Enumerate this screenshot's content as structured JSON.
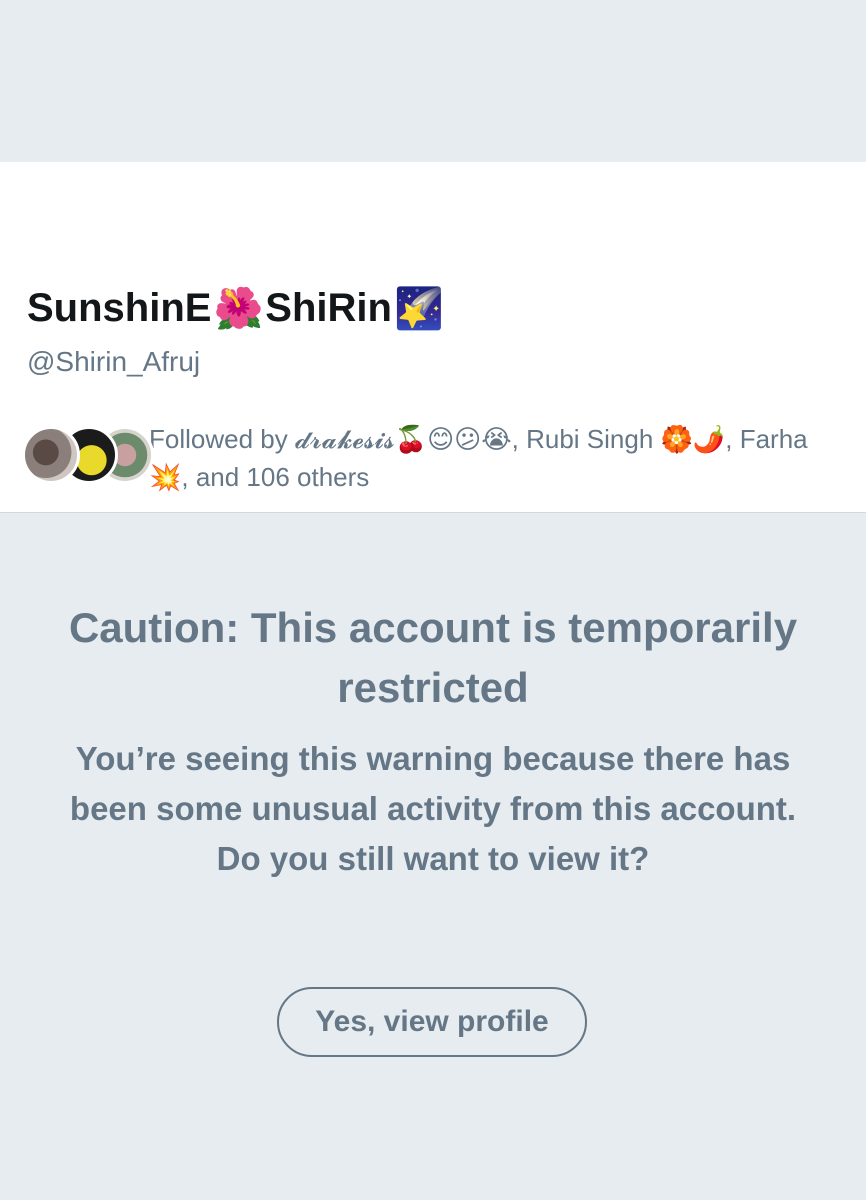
{
  "profile": {
    "name_part1": "SunshinE",
    "name_emoji1": "🌺",
    "name_part2": "ShiRin",
    "name_emoji2": "🌠",
    "handle": "@Shirin_Afruj"
  },
  "followed_by": {
    "text": "Followed by 𝓭𝓻𝓪𝓴𝓮𝓼𝓲𝓼🍒😊😕😭, Rubi Singh 🏵️🌶️, Farha💥, and 106 others"
  },
  "warning": {
    "title": "Caution: This account is temporarily restricted",
    "body": "You’re seeing this warning because there has been some unusual activity from this account. Do you still want to view it?",
    "button_label": "Yes, view profile"
  },
  "colors": {
    "background": "#e6ecf0",
    "text_primary": "#14171a",
    "text_secondary": "#657786"
  }
}
